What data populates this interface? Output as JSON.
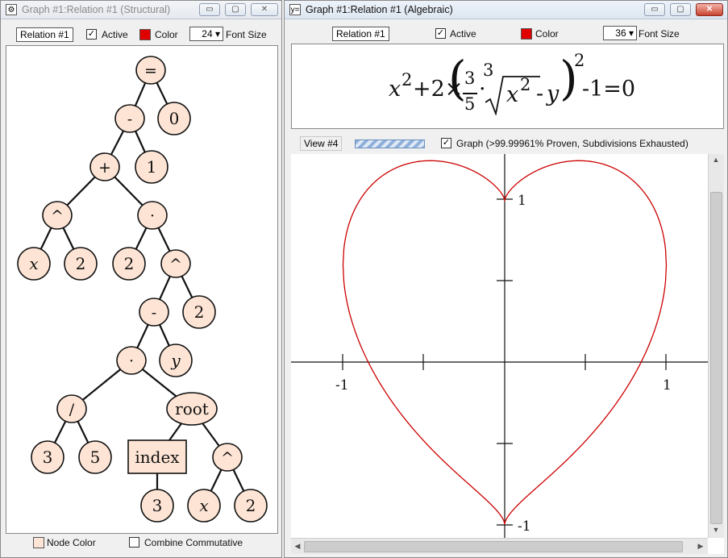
{
  "structural_window": {
    "title": "Graph #1:Relation #1 (Structural)",
    "relation_button": "Relation #1",
    "active_label": "Active",
    "active_checked": true,
    "color_label": "Color",
    "color_value": "#e00000",
    "font_size_value": "24",
    "font_size_label": "Font Size",
    "node_color_label": "Node Color",
    "combine_commutative_label": "Combine Commutative",
    "combine_commutative_checked": false,
    "node_fill": "#fde4d4",
    "tree": {
      "eq": "=",
      "minus1": "-",
      "zero": "0",
      "plus": "+",
      "one": "1",
      "pow1": "^",
      "dot1": "·",
      "x1": "x",
      "two1": "2",
      "two2": "2",
      "pow2": "^",
      "minus2": "-",
      "two3": "2",
      "dot2": "·",
      "y": "y",
      "div": "/",
      "root": "root",
      "three1": "3",
      "five": "5",
      "index": "index",
      "pow3": "^",
      "three2": "3",
      "x2": "x",
      "two4": "2"
    }
  },
  "algebraic_window": {
    "title": "Graph #1:Relation #1 (Algebraic)",
    "relation_button": "Relation #1",
    "active_label": "Active",
    "active_checked": true,
    "color_label": "Color",
    "color_value": "#e00000",
    "font_size_value": "36",
    "font_size_label": "Font Size",
    "formula": {
      "x": "x",
      "exp2": "2",
      "plus": "+2×",
      "num": "3",
      "den": "5",
      "dot": "·",
      "root_index": "3",
      "x_in_root": "x",
      "x_in_root_exp": "2",
      "minus_y": "-",
      "y": "y",
      "outer_exp": "2",
      "tail": "-1=0"
    }
  },
  "graph_view": {
    "view_button": "View #4",
    "graph_label": "Graph (>99.99961% Proven, Subdivisions Exhausted)",
    "graph_checked": true,
    "progress_pct": 100,
    "curve_color": "#cc0000",
    "tick_labels": {
      "x_neg": "-1",
      "x_pos": "1",
      "y_pos": "1",
      "y_neg": "-1"
    }
  }
}
